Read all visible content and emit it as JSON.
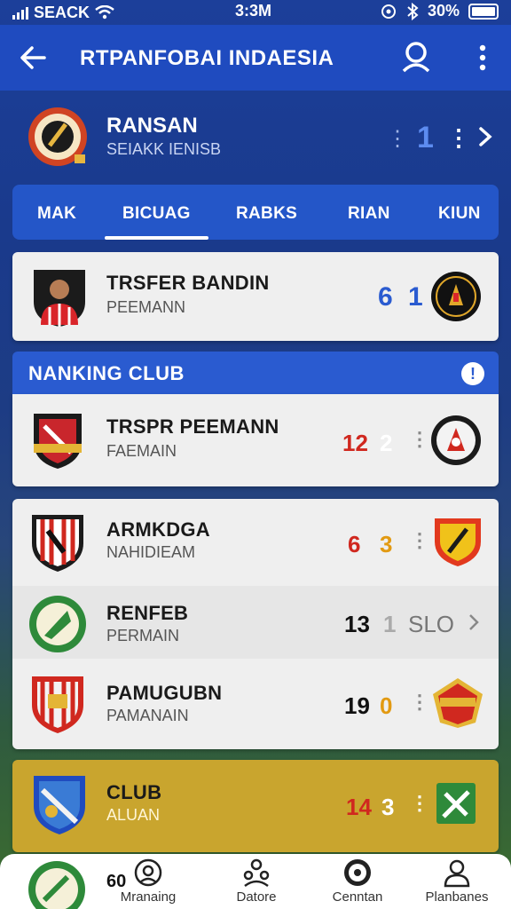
{
  "status_bar": {
    "carrier": "SEACK",
    "time": "3:3M",
    "battery": "30%"
  },
  "app_bar": {
    "title": "RTPANFOBAI INDAESIA",
    "back_icon": "arrow-left-icon",
    "search_icon": "search-icon",
    "more_icon": "more-vertical-icon"
  },
  "team_header": {
    "name": "RANSAN",
    "subtitle": "SEIAKK IENISB",
    "counter": "1"
  },
  "tabs": [
    {
      "label": "MAK",
      "active": false
    },
    {
      "label": "BICUAG",
      "active": true
    },
    {
      "label": "RABKS",
      "active": false
    },
    {
      "label": "RIAN",
      "active": false
    },
    {
      "label": "KIUN",
      "active": false
    }
  ],
  "featured": {
    "title": "TRSFER BANDIN",
    "subtitle": "PEEMANN",
    "score_a": "6",
    "score_b": "1"
  },
  "ranking": {
    "header": "NANKING CLUB",
    "info_icon": "info-icon",
    "rows": [
      {
        "title": "TRSPR PEEMANN",
        "subtitle": "FAEMAIN",
        "score_a": "12",
        "score_b": "2"
      },
      {
        "title": "ARMKDGA",
        "subtitle": "NAHIDIEAM",
        "score_a": "6",
        "score_b": "3"
      },
      {
        "title": "RENFEB",
        "subtitle": "PERMAIN",
        "score_a": "13",
        "score_b": "1",
        "extra": "SLO"
      },
      {
        "title": "PAMUGUBN",
        "subtitle": "PAMANAIN",
        "score_a": "19",
        "score_b": "0"
      }
    ]
  },
  "club_card": {
    "title": "CLUB",
    "subtitle": "ALUAN",
    "score_a": "14",
    "score_b": "3"
  },
  "bottom_nav": {
    "partial_number": "60",
    "items": [
      {
        "label": "Mranaing",
        "icon": "face-icon"
      },
      {
        "label": "Datore",
        "icon": "people-icon"
      },
      {
        "label": "Cenntan",
        "icon": "ball-icon"
      },
      {
        "label": "Planbanes",
        "icon": "profile-icon"
      }
    ]
  },
  "colors": {
    "primary": "#1f4bbf",
    "tab_bar": "#2456c8",
    "section_header": "#2a5bd0",
    "score_red": "#d0281f",
    "score_orange": "#e29a12",
    "club_card": "#c9a52e"
  }
}
